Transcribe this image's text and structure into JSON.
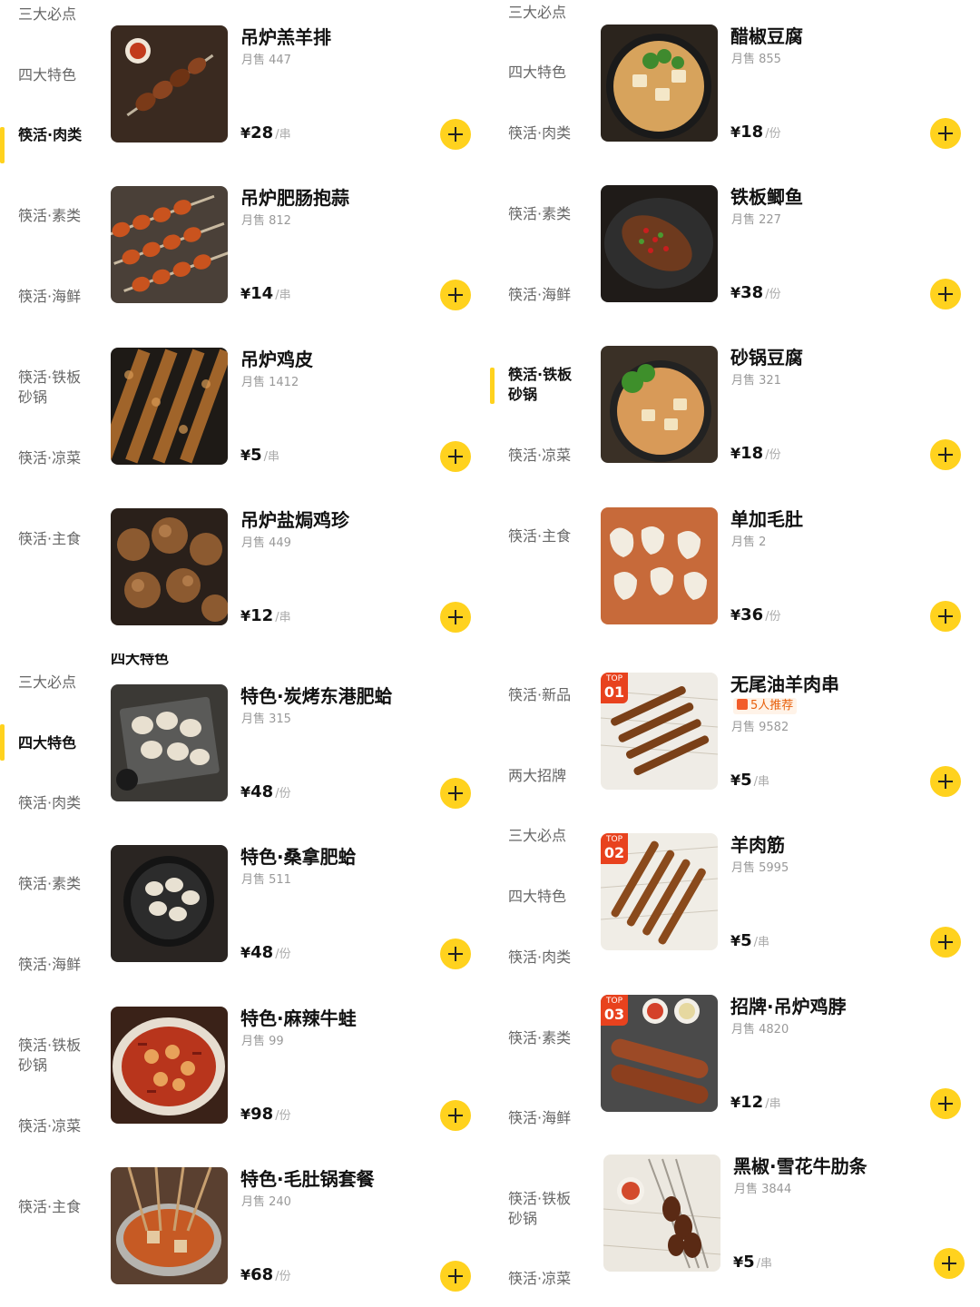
{
  "colors": {
    "accent": "#ffd21e",
    "top_badge": "#e8421e"
  },
  "panels": [
    {
      "sidebar": [
        {
          "label": "三大必点",
          "active": false
        },
        {
          "label": "四大特色",
          "active": false
        },
        {
          "label": "筷活·肉类",
          "active": true
        },
        {
          "label": "筷活·素类",
          "active": false
        },
        {
          "label": "筷活·海鲜",
          "active": false
        },
        {
          "label": "筷活·铁板砂锅",
          "active": false
        },
        {
          "label": "筷活·凉菜",
          "active": false
        },
        {
          "label": "筷活·主食",
          "active": false
        }
      ],
      "items": [
        {
          "name": "吊炉羔羊排",
          "sales": "月售 447",
          "yen": "¥",
          "amount": "28",
          "unit": "/串",
          "image": "lamb-chop-skewer"
        },
        {
          "name": "吊炉肥肠抱蒜",
          "sales": "月售 812",
          "yen": "¥",
          "amount": "14",
          "unit": "/串",
          "image": "intestine-garlic-skewer"
        },
        {
          "name": "吊炉鸡皮",
          "sales": "月售 1412",
          "yen": "¥",
          "amount": "5",
          "unit": "/串",
          "image": "chicken-skin-skewer"
        },
        {
          "name": "吊炉盐焗鸡珍",
          "sales": "月售 449",
          "yen": "¥",
          "amount": "12",
          "unit": "/串",
          "image": "gizzard-skewer"
        }
      ]
    },
    {
      "sidebar": [
        {
          "label": "三大必点",
          "active": false
        },
        {
          "label": "四大特色",
          "active": false
        },
        {
          "label": "筷活·肉类",
          "active": false
        },
        {
          "label": "筷活·素类",
          "active": false
        },
        {
          "label": "筷活·海鲜",
          "active": false
        },
        {
          "label": "筷活·铁板砂锅",
          "active": true
        },
        {
          "label": "筷活·凉菜",
          "active": false
        },
        {
          "label": "筷活·主食",
          "active": false
        }
      ],
      "items": [
        {
          "name": "醋椒豆腐",
          "sales": "月售 855",
          "yen": "¥",
          "amount": "18",
          "unit": "/份",
          "image": "vinegar-pepper-tofu"
        },
        {
          "name": "铁板鲫鱼",
          "sales": "月售 227",
          "yen": "¥",
          "amount": "38",
          "unit": "/份",
          "image": "iron-plate-fish"
        },
        {
          "name": "砂锅豆腐",
          "sales": "月售 321",
          "yen": "¥",
          "amount": "18",
          "unit": "/份",
          "image": "clay-pot-tofu"
        },
        {
          "name": "单加毛肚",
          "sales": "月售 2",
          "yen": "¥",
          "amount": "36",
          "unit": "/份",
          "image": "tripe"
        }
      ]
    },
    {
      "cut_heading": "四大特色",
      "sidebar": [
        {
          "label": "三大必点",
          "active": false
        },
        {
          "label": "四大特色",
          "active": true
        },
        {
          "label": "筷活·肉类",
          "active": false
        },
        {
          "label": "筷活·素类",
          "active": false
        },
        {
          "label": "筷活·海鲜",
          "active": false
        },
        {
          "label": "筷活·铁板砂锅",
          "active": false
        },
        {
          "label": "筷活·凉菜",
          "active": false
        },
        {
          "label": "筷活·主食",
          "active": false
        }
      ],
      "items": [
        {
          "name": "特色·炭烤东港肥蛤",
          "sales": "月售 315",
          "yen": "¥",
          "amount": "48",
          "unit": "/份",
          "image": "grilled-clams"
        },
        {
          "name": "特色·桑拿肥蛤",
          "sales": "月售 511",
          "yen": "¥",
          "amount": "48",
          "unit": "/份",
          "image": "sauna-clams"
        },
        {
          "name": "特色·麻辣牛蛙",
          "sales": "月售 99",
          "yen": "¥",
          "amount": "98",
          "unit": "/份",
          "image": "spicy-bullfrog"
        },
        {
          "name": "特色·毛肚锅套餐",
          "sales": "月售 240",
          "yen": "¥",
          "amount": "68",
          "unit": "/份",
          "image": "tripe-hotpot-set"
        }
      ]
    },
    {
      "sidebar": [
        {
          "label": "筷活·新品",
          "active": false
        },
        {
          "label": "两大招牌",
          "active": false
        },
        {
          "label": "三大必点",
          "active": false
        },
        {
          "label": "四大特色",
          "active": false
        },
        {
          "label": "筷活·肉类",
          "active": false
        },
        {
          "label": "筷活·素类",
          "active": false
        },
        {
          "label": "筷活·海鲜",
          "active": false
        },
        {
          "label": "筷活·铁板砂锅",
          "active": false
        },
        {
          "label": "筷活·凉菜",
          "active": false
        }
      ],
      "items": [
        {
          "name": "无尾油羊肉串",
          "recommend": "5人推荐",
          "sales": "月售 9582",
          "yen": "¥",
          "amount": "5",
          "unit": "/串",
          "badge_top": "TOP",
          "badge_num": "01",
          "image": "lamb-skewers"
        },
        {
          "name": "羊肉筋",
          "sales": "月售 5995",
          "yen": "¥",
          "amount": "5",
          "unit": "/串",
          "badge_top": "TOP",
          "badge_num": "02",
          "image": "lamb-tendon-skewers"
        },
        {
          "name": "招牌·吊炉鸡脖",
          "sales": "月售 4820",
          "yen": "¥",
          "amount": "12",
          "unit": "/串",
          "badge_top": "TOP",
          "badge_num": "03",
          "image": "chicken-neck"
        },
        {
          "name": "黑椒·雪花牛肋条",
          "sales": "月售 3844",
          "yen": "¥",
          "amount": "5",
          "unit": "/串",
          "image": "beef-rib-skewers"
        }
      ]
    }
  ]
}
